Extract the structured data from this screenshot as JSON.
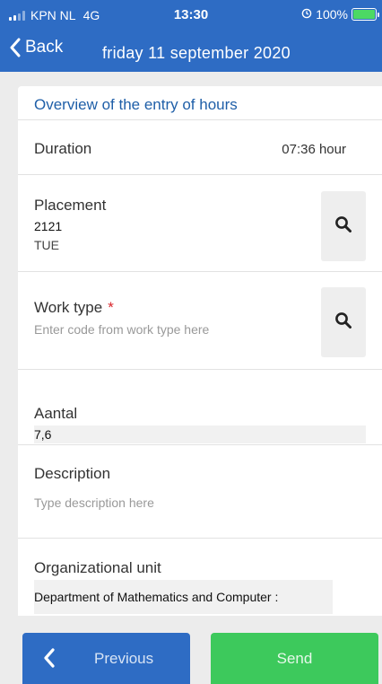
{
  "status_bar": {
    "carrier": "KPN NL",
    "network": "4G",
    "time": "13:30",
    "battery": "100%"
  },
  "nav": {
    "back_label": "Back",
    "title": "friday 11 september 2020"
  },
  "card": {
    "title": "Overview of the entry of hours",
    "duration": {
      "label": "Duration",
      "value": "07:36 hour"
    },
    "placement": {
      "label": "Placement",
      "code": "2121",
      "name": "TUE"
    },
    "work_type": {
      "label": "Work type",
      "required_mark": "*",
      "placeholder": "Enter code from work type here"
    },
    "aantal": {
      "label": "Aantal",
      "value": "7,6"
    },
    "description": {
      "label": "Description",
      "placeholder": "Type description here"
    },
    "org_unit": {
      "label": "Organizational unit",
      "value": "Department of Mathematics and Computer :"
    }
  },
  "buttons": {
    "previous_label": "Previous",
    "send_label": "Send"
  },
  "colors": {
    "header": "#2e6cc4",
    "previous_button": "#2e6cc4",
    "send_button": "#3dc95c",
    "card_title": "#1f5fa8",
    "required": "#d9262c"
  },
  "icons": [
    "signal-icon",
    "alarm-icon",
    "battery-icon",
    "back-chevron-icon",
    "search-icon",
    "previous-chevron-icon"
  ]
}
